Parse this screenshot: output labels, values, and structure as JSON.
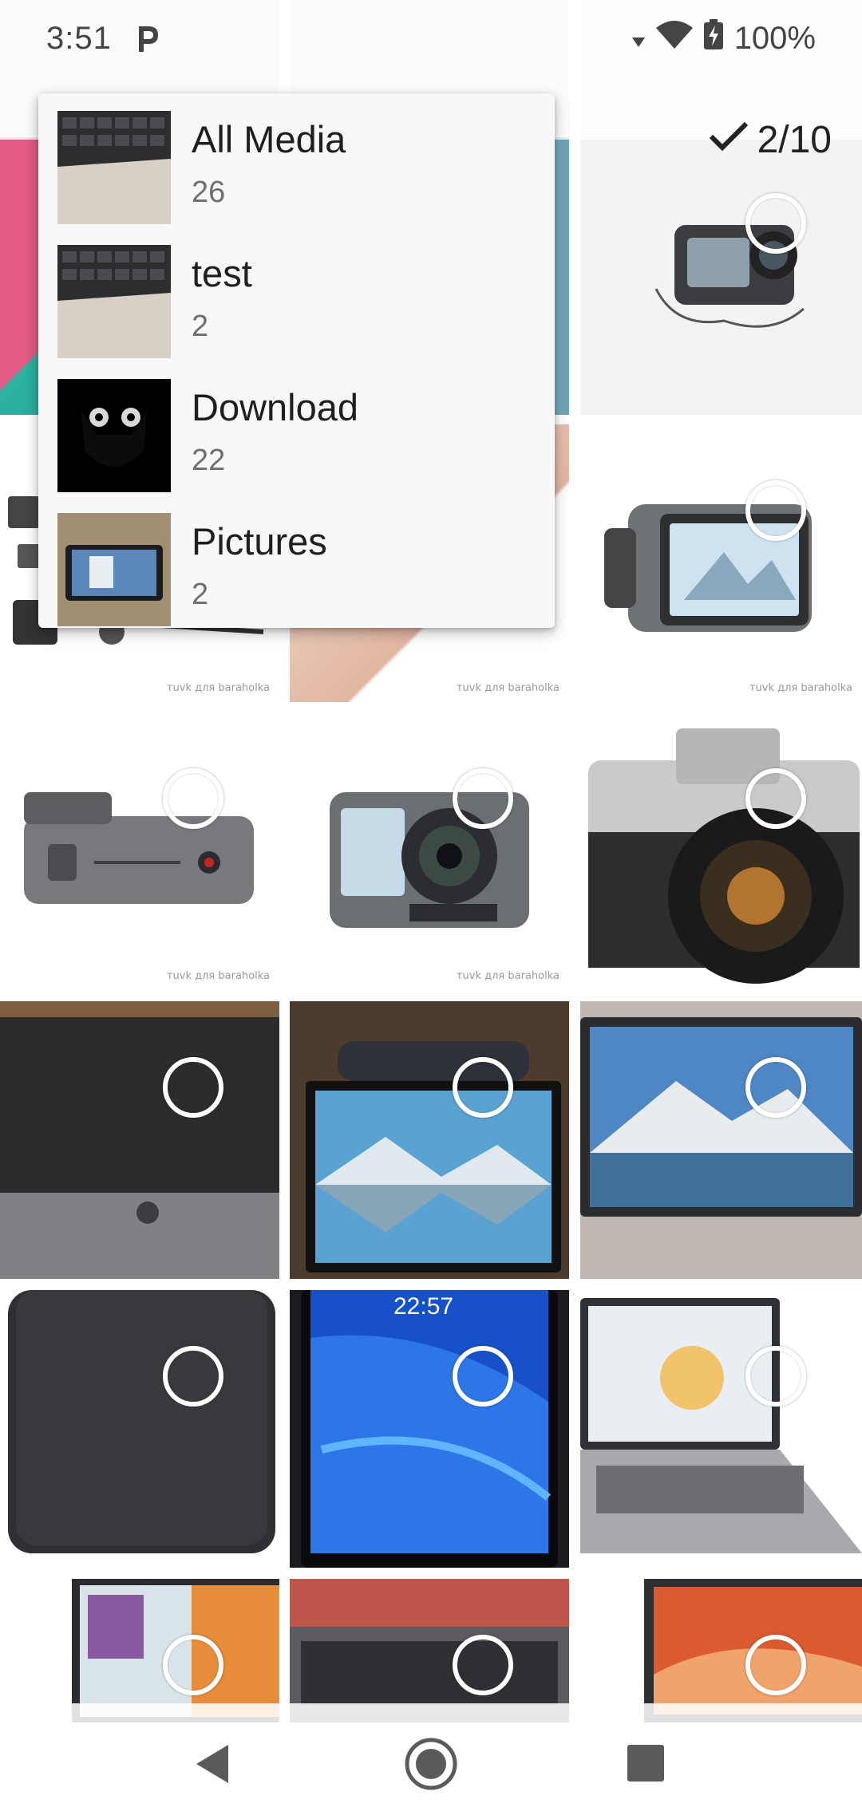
{
  "status_bar": {
    "time": "3:51",
    "battery": "100%"
  },
  "selection": {
    "counter": "2/10"
  },
  "album_menu": {
    "items": [
      {
        "name": "All Media",
        "count": "26"
      },
      {
        "name": "test",
        "count": "2"
      },
      {
        "name": "Download",
        "count": "22"
      },
      {
        "name": "Pictures",
        "count": "2"
      }
    ]
  },
  "grid": {
    "watermark_text": "тuvk для baraholka"
  },
  "icons": {
    "status_app": "p-icon",
    "wifi": "wifi-icon",
    "battery": "battery-charging-icon",
    "check": "check-icon",
    "back": "back-triangle-icon",
    "home": "home-circle-icon",
    "recents": "recents-square-icon"
  },
  "colors": {
    "accent_dark": "#222222",
    "menu_bg": "#f8f7f9"
  }
}
